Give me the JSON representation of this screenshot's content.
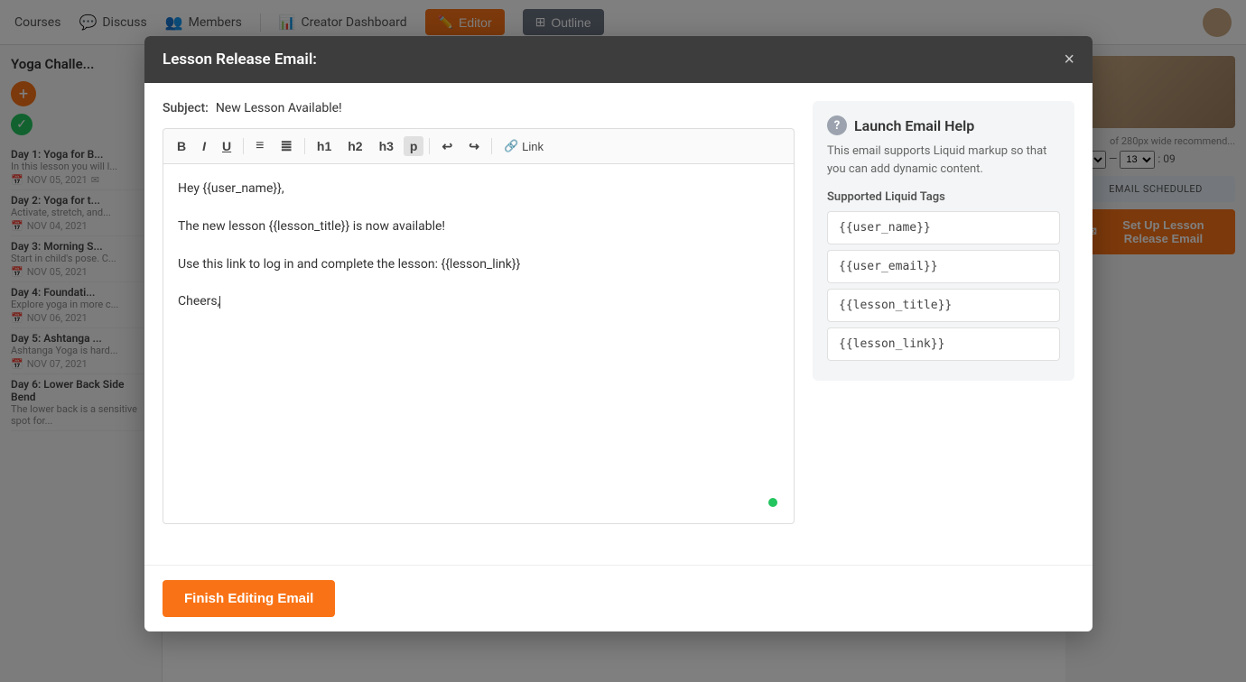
{
  "nav": {
    "courses_label": "Courses",
    "discuss_label": "Discuss",
    "members_label": "Members",
    "creator_dashboard_label": "Creator Dashboard",
    "editor_label": "Editor",
    "outline_label": "Outline"
  },
  "background": {
    "course_title": "Yoga Challe...",
    "lessons": [
      {
        "title": "Day 1: Yoga for B...",
        "desc": "In this lesson you will l...",
        "date": "NOV 05, 2021"
      },
      {
        "title": "Day 2: Yoga for t...",
        "desc": "Activate, stretch, and...",
        "date": "NOV 04, 2021"
      },
      {
        "title": "Day 3: Morning S...",
        "desc": "Start in child's pose. C...",
        "date": "NOV 05, 2021"
      },
      {
        "title": "Day 4: Foundati...",
        "desc": "Explore yoga in more c...",
        "date": "NOV 06, 2021"
      },
      {
        "title": "Day 5: Ashtanga ...",
        "desc": "Ashtanga Yoga is hard...",
        "date": "NOV 07, 2021"
      },
      {
        "title": "Day 6: Lower Back Side Bend",
        "desc": "The lower back is a sensitive spot for...",
        "date": ""
      }
    ],
    "email_scheduled": "EMAIL SCHEDULED",
    "setup_btn": "Set Up Lesson Release Email"
  },
  "modal": {
    "title": "Lesson Release Email:",
    "close_label": "×",
    "subject_label": "Subject:",
    "subject_value": "New Lesson Available!",
    "toolbar": {
      "bold": "B",
      "italic": "I",
      "underline": "U",
      "bullet_list": "≡",
      "ordered_list": "≣",
      "h1": "h1",
      "h2": "h2",
      "h3": "h3",
      "p": "p",
      "undo": "↩",
      "redo": "↪",
      "link": "Link"
    },
    "body_lines": [
      "Hey {{user_name}},",
      "",
      "The new lesson {{lesson_title}} is now available!",
      "",
      "Use this link to log in and complete the lesson: {{lesson_link}}",
      "",
      "Cheers,"
    ],
    "finish_btn": "Finish Editing Email"
  },
  "help_panel": {
    "title": "Launch Email Help",
    "icon": "?",
    "description": "This email supports Liquid markup so that you can add dynamic content.",
    "section_title": "Supported Liquid Tags",
    "tags": [
      "{{user_name}}",
      "{{user_email}}",
      "{{lesson_title}}",
      "{{lesson_link}}"
    ]
  }
}
